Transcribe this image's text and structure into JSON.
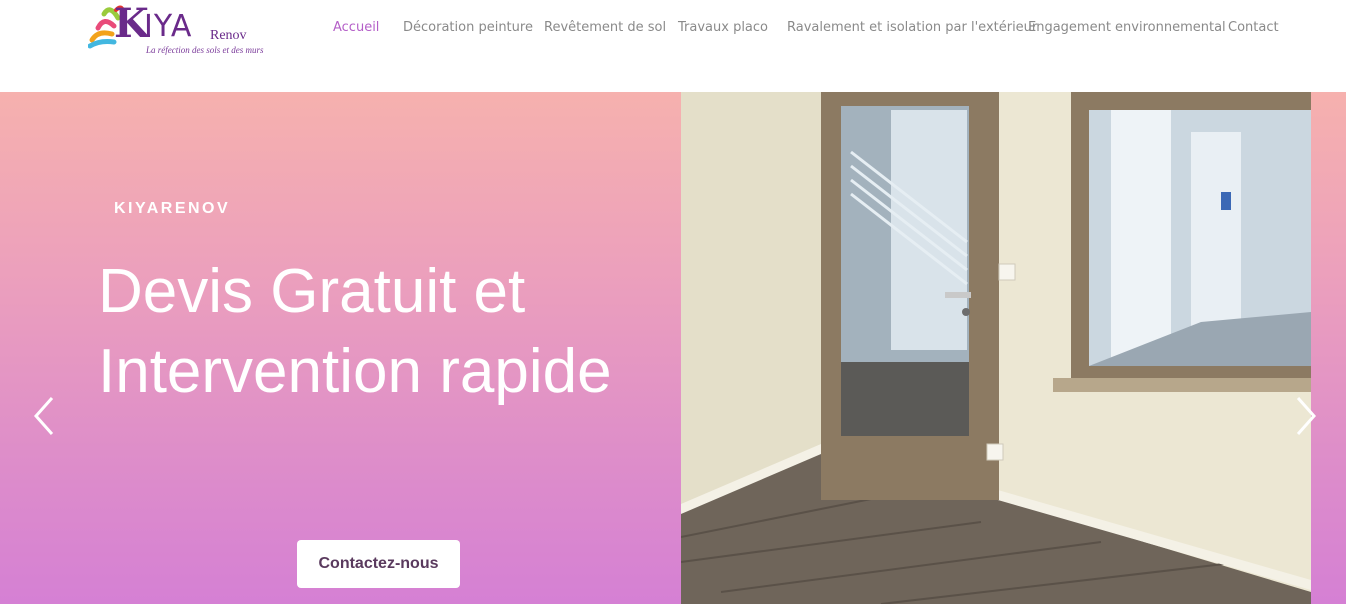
{
  "logo": {
    "k": "K",
    "iya": "IYA",
    "renov": "Renov",
    "tagline": "La réfection des sols et des murs"
  },
  "nav": {
    "items": [
      {
        "label": "Accueil",
        "active": true
      },
      {
        "label": "Décoration peinture"
      },
      {
        "label": "Revêtement de sol"
      },
      {
        "label": "Travaux placo"
      },
      {
        "label": "Ravalement et isolation par l'extérieur"
      },
      {
        "label": "Engagement environnemental"
      },
      {
        "label": "Contact"
      }
    ]
  },
  "hero": {
    "kicker": "KIYARENOV",
    "headline": "Devis Gratuit et Intervention rapide",
    "cta_label": "Contactez-nous"
  },
  "icons": {
    "prev": "chevron-left-icon",
    "next": "chevron-right-icon"
  },
  "colors": {
    "nav_active": "#b45fc8",
    "nav_default": "#8a8a8a",
    "gradient_top": "#f6b1ae",
    "gradient_bottom": "#d580d4",
    "cta_text": "#5a3a5e"
  }
}
